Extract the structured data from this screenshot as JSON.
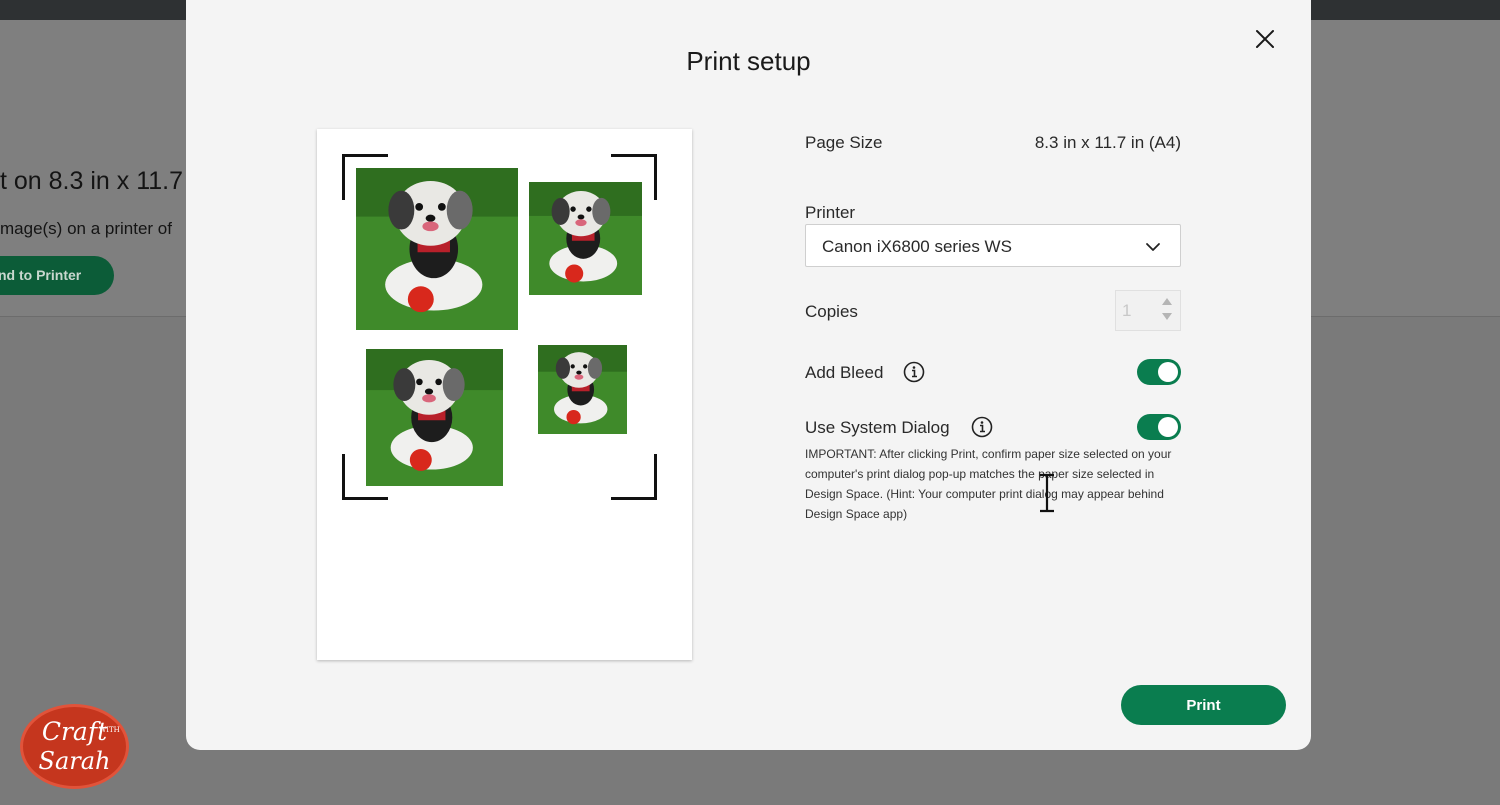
{
  "background": {
    "heading_partial": "t on 8.3 in x 11.7",
    "subtext_partial": "mage(s) on a printer of",
    "send_button_partial": "nd to Printer"
  },
  "modal": {
    "title": "Print setup",
    "close_icon": "close-icon",
    "page_size": {
      "label": "Page Size",
      "value": "8.3 in x 11.7 in (A4)"
    },
    "printer": {
      "label": "Printer",
      "selected": "Canon iX6800 series WS",
      "icon": "chevron-down-icon"
    },
    "copies": {
      "label": "Copies",
      "value": "1"
    },
    "add_bleed": {
      "label": "Add Bleed",
      "enabled": true,
      "icon": "info-icon"
    },
    "system_dialog": {
      "label": "Use System Dialog",
      "enabled": true,
      "icon": "info-icon",
      "note": "IMPORTANT: After clicking Print, confirm paper size selected on your computer's print dialog pop-up matches the paper size selected in Design Space. (Hint: Your computer print dialog may appear behind Design Space app)"
    },
    "print_button": "Print"
  },
  "logo": {
    "line1": "Craft",
    "line2": "WITH",
    "line3": "Sarah"
  },
  "colors": {
    "accent": "#0a7d4f",
    "modal_bg": "#f4f4f4",
    "overlay": "#7a7a7a"
  }
}
